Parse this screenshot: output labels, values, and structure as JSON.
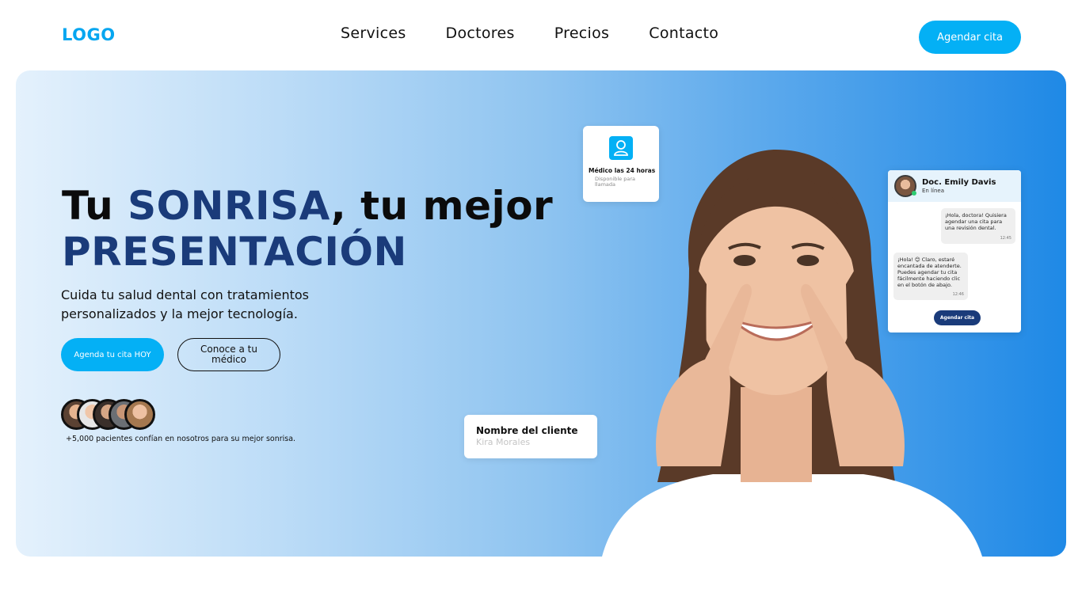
{
  "header": {
    "logo": "LOGO",
    "nav": [
      "Services",
      "Doctores",
      "Precios",
      "Contacto"
    ],
    "cta": "Agendar cita"
  },
  "hero": {
    "title_part1": "Tu ",
    "title_accent1": "SONRISA",
    "title_part2": ", tu mejor",
    "title_accent2": "PRESENTACIÓN",
    "subtitle": "Cuida tu salud dental con tratamientos personalizados y la mejor tecnología.",
    "primary_button": "Agenda tu cita HOY",
    "secondary_button": "Conoce a tu médico",
    "patients_text": "+5,000 pacientes confían en nosotros para su mejor sonrisa."
  },
  "card_doctor": {
    "title": "Médico las 24 horas",
    "subtitle": "Disponible para llamada"
  },
  "card_client": {
    "label": "Nombre del cliente",
    "value": "Kira Morales"
  },
  "chat": {
    "doctor_name": "Doc. Emily Davis",
    "status": "En línea",
    "message_user": "¡Hola, doctora! Quisiera agendar una cita para una revisión dental.",
    "message_user_time": "12:45",
    "message_doctor": "¡Hola! 😊 Claro, estaré encantada de atenderte. Puedes agendar tu cita fácilmente haciendo clic en el botón de abajo.",
    "message_doctor_time": "12:46",
    "button": "Agendar cita"
  },
  "colors": {
    "accent": "#04b0f5",
    "navy": "#1a3b7a",
    "gradient_start": "#e4f1fc",
    "gradient_end": "#1f89e6"
  }
}
